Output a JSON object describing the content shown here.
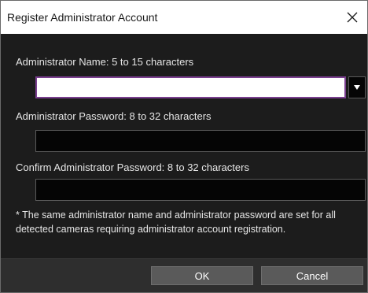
{
  "window": {
    "title": "Register Administrator Account",
    "close_icon": "close-icon"
  },
  "form": {
    "name_label": "Administrator Name:  5 to 15 characters",
    "name_value": "",
    "password_label": "Administrator Password:  8 to 32 characters",
    "password_value": "",
    "confirm_label": "Confirm Administrator Password:  8 to 32 characters",
    "confirm_value": "",
    "dropdown_icon": "caret-down-icon"
  },
  "note": "* The same administrator name and administrator password are set for all detected cameras requiring administrator account registration.",
  "buttons": {
    "ok": "OK",
    "cancel": "Cancel"
  },
  "colors": {
    "background": "#1c1c1c",
    "focus_border": "#7a3f8f",
    "button": "#5a5a5a"
  }
}
